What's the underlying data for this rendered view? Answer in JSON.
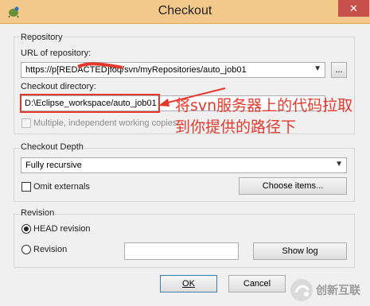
{
  "window": {
    "title": "Checkout",
    "close_symbol": "✕"
  },
  "repository": {
    "group_label": "Repository",
    "url_label": "URL of repository:",
    "url_value": "https://p[REDACTED]foq/svn/myRepositories/auto_job01",
    "browse_label": "...",
    "checkout_dir_label": "Checkout directory:",
    "checkout_dir_value": "D:\\Eclipse_workspace/auto_job01",
    "multiple_copies_label": "Multiple, independent working copies"
  },
  "depth": {
    "group_label": "Checkout Depth",
    "depth_value": "Fully recursive",
    "omit_externals_label": "Omit externals",
    "choose_items_label": "Choose items..."
  },
  "revision": {
    "group_label": "Revision",
    "head_label": "HEAD revision",
    "revision_label": "Revision",
    "revision_value": "",
    "show_log_label": "Show log"
  },
  "footer": {
    "ok_label": "OK",
    "cancel_label": "Cancel"
  },
  "annotation": {
    "line1": "将svn服务器上的代码拉取",
    "line2": "到你提供的路径下"
  },
  "watermark": {
    "brand_text": "创新互联"
  },
  "colors": {
    "annotation_red": "#e5382c",
    "titlebar": "#f3c98b",
    "close_button": "#c7504a"
  }
}
